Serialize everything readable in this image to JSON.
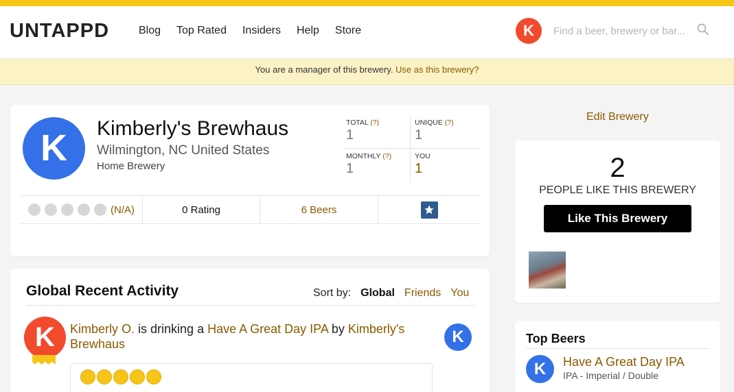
{
  "header": {
    "logo": "UNTAPPD",
    "nav": [
      "Blog",
      "Top Rated",
      "Insiders",
      "Help",
      "Store"
    ],
    "user_initial": "K",
    "search_placeholder": "Find a beer, brewery or bar..."
  },
  "banner": {
    "text": "You are a manager of this brewery.",
    "link": "Use as this brewery?"
  },
  "brewery": {
    "initial": "K",
    "name": "Kimberly's Brewhaus",
    "location": "Wilmington, NC United States",
    "type": "Home Brewery",
    "stats": {
      "total_label": "TOTAL",
      "total_value": "1",
      "unique_label": "UNIQUE",
      "unique_value": "1",
      "monthly_label": "MONTHLY",
      "monthly_value": "1",
      "you_label": "YOU",
      "you_value": "1",
      "help": "(?)"
    },
    "rating_score": "(N/A)",
    "rating_count": "0 Rating",
    "beers": "6 Beers"
  },
  "activity": {
    "title": "Global Recent Activity",
    "sort_label": "Sort by:",
    "sort_options": [
      "Global",
      "Friends",
      "You"
    ],
    "item": {
      "user_initial": "K",
      "user": "Kimberly O.",
      "verb": " is drinking a ",
      "beer": "Have A Great Day IPA",
      "by": " by ",
      "brewery": "Kimberly's Brewhaus",
      "brewery_initial": "K",
      "rating_caps": 5
    }
  },
  "sidebar": {
    "edit_link": "Edit Brewery",
    "like_count": "2",
    "like_label": "PEOPLE LIKE THIS BREWERY",
    "like_button": "Like This Brewery",
    "top_beers_title": "Top Beers",
    "top_beer": {
      "initial": "K",
      "name": "Have A Great Day IPA",
      "style": "IPA - Imperial / Double"
    }
  },
  "colors": {
    "accent": "#f5c518",
    "link": "#8a5a00",
    "brewery_blue": "#3470e8",
    "user_red": "#f24a2d"
  }
}
